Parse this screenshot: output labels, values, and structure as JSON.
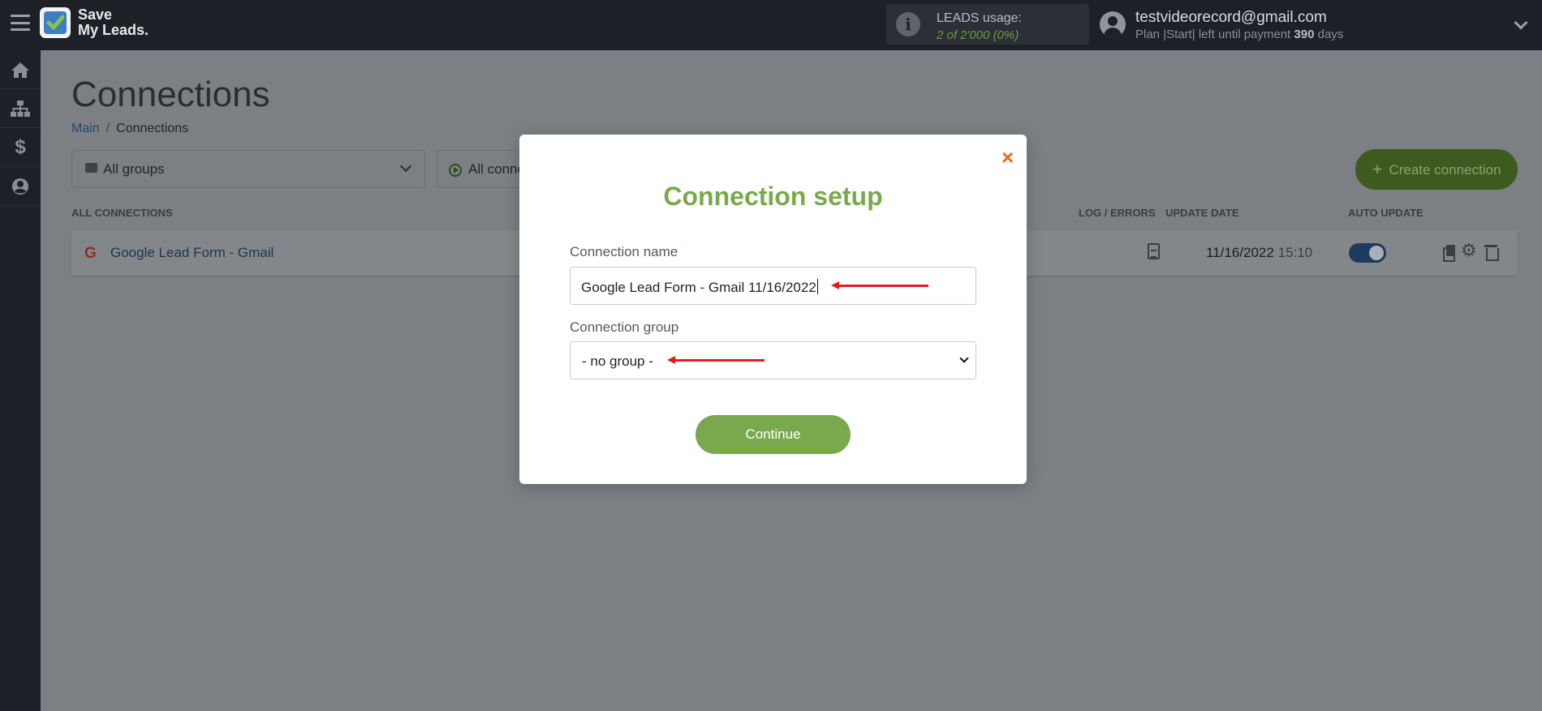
{
  "header": {
    "logo_line1": "Save",
    "logo_line2": "My Leads.",
    "leads_title": "LEADS usage:",
    "leads_value": "2 of 2'000 (0%)",
    "user_email": "testvideorecord@gmail.com",
    "plan_prefix": "Plan |Start| left until payment",
    "plan_days": "390",
    "plan_suffix": "days"
  },
  "sidebar": {
    "icons": [
      "home-icon",
      "sitemap-icon",
      "dollar-icon",
      "account-icon"
    ]
  },
  "page": {
    "title": "Connections",
    "breadcrumb": [
      {
        "label": "Main",
        "link": true
      },
      {
        "label": "Connections",
        "link": false
      }
    ],
    "filters": {
      "groups_label": "All groups",
      "connections_label": "All conne"
    },
    "create_button": "Create connection",
    "columns": {
      "all": "ALL CONNECTIONS",
      "log": "LOG / ERRORS",
      "update_date": "UPDATE DATE",
      "auto_update": "AUTO UPDATE"
    },
    "connections": [
      {
        "icon": "G",
        "name": "Google Lead Form - Gmail",
        "date": "11/16/2022",
        "time": "15:10",
        "auto_update": true
      }
    ]
  },
  "modal": {
    "close": "×",
    "title": "Connection setup",
    "name_label": "Connection name",
    "name_value": "Google Lead Form - Gmail 11/16/2022",
    "group_label": "Connection group",
    "group_value": "- no group -",
    "continue": "Continue"
  },
  "colors": {
    "accent_green": "#7aa94d",
    "close_orange": "#e26b1c",
    "arrow_red": "#e01e1e",
    "toggle_blue": "#1d3a5f"
  }
}
